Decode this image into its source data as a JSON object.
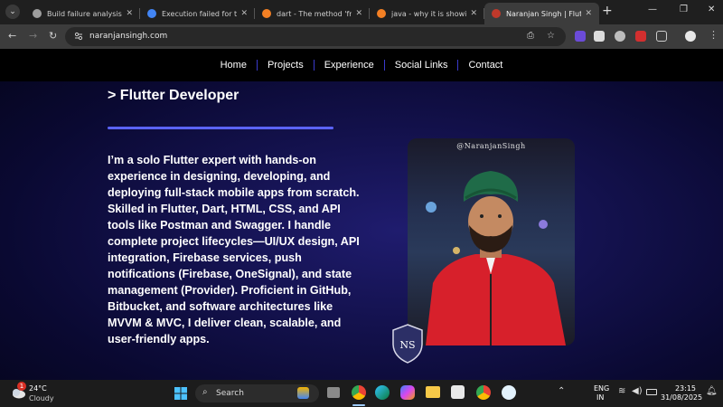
{
  "browser": {
    "tabs": [
      {
        "title": "Build failure analysis",
        "favicon": "gear-icon",
        "color": "#9e9e9e"
      },
      {
        "title": "Execution failed for task",
        "favicon": "google-icon",
        "color": "#4285f4"
      },
      {
        "title": "dart - The method 'fromJ",
        "favicon": "stackoverflow-icon",
        "color": "#f48024"
      },
      {
        "title": "java - why it is showing e",
        "favicon": "stackoverflow-icon",
        "color": "#f48024"
      },
      {
        "title": "Naranjan Singh | Flutter D",
        "favicon": "avatar-icon",
        "color": "#c0392b"
      }
    ],
    "url": "naranjansingh.com"
  },
  "site": {
    "nav": [
      "Home",
      "Projects",
      "Experience",
      "Social Links",
      "Contact"
    ],
    "role": "> Flutter Developer",
    "bio": "I’m a solo Flutter expert with hands-on experience in designing, developing, and deploying full-stack mobile apps from scratch. Skilled in Flutter, Dart, HTML, CSS, and API tools like Postman and Swagger. I handle complete project lifecycles—UI/UX design, API integration, Firebase services, push notifications (Firebase, OneSignal), and state management (Provider). Proficient in GitHub, Bitbucket, and software architectures like MVVM & MVC, I deliver clean, scalable, and user-friendly apps.",
    "photo_handle": "@NaranjanSingh",
    "badge_text": "NS",
    "accent_color": "#5b63ff"
  },
  "taskbar": {
    "weather_temp": "24°C",
    "weather_desc": "Cloudy",
    "weather_badge": "1",
    "search_label": "Search",
    "lang_1": "ENG",
    "lang_2": "IN",
    "time": "23:15",
    "date": "31/08/2025"
  }
}
